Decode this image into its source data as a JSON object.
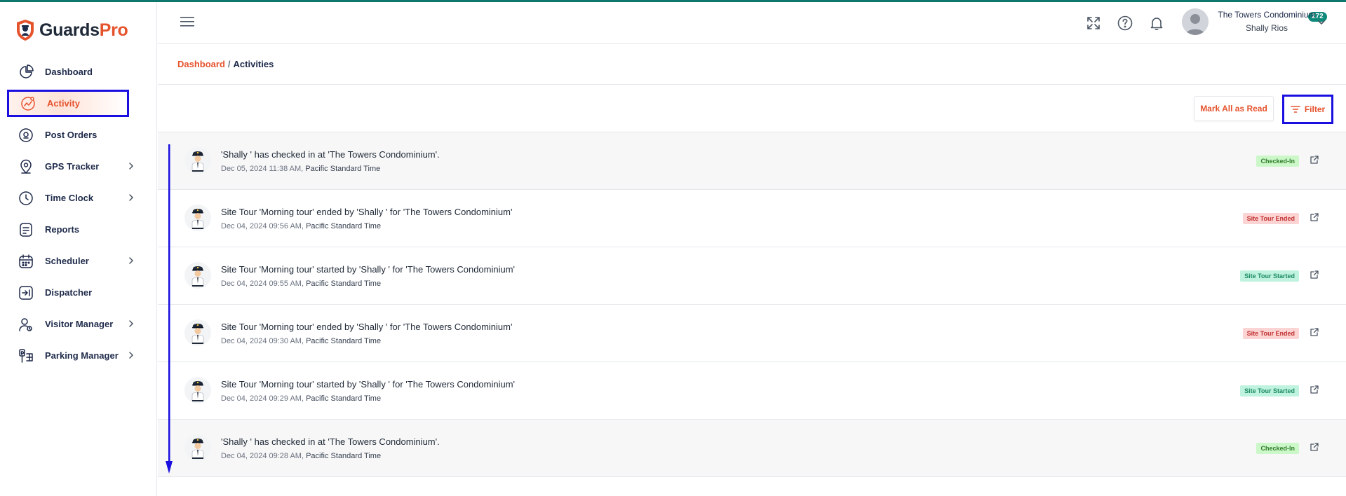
{
  "brand": {
    "name_part1": "Guards",
    "name_part2": "Pro"
  },
  "sidebar": {
    "items": [
      {
        "label": "Dashboard",
        "icon": "pie-chart-icon",
        "has_chevron": false
      },
      {
        "label": "Activity",
        "icon": "activity-icon",
        "has_chevron": false,
        "active": true
      },
      {
        "label": "Post Orders",
        "icon": "location-pin-icon",
        "has_chevron": false
      },
      {
        "label": "GPS Tracker",
        "icon": "map-pin-icon",
        "has_chevron": true
      },
      {
        "label": "Time Clock",
        "icon": "clock-icon",
        "has_chevron": true
      },
      {
        "label": "Reports",
        "icon": "report-icon",
        "has_chevron": false
      },
      {
        "label": "Scheduler",
        "icon": "calendar-icon",
        "has_chevron": true
      },
      {
        "label": "Dispatcher",
        "icon": "dispatch-icon",
        "has_chevron": false
      },
      {
        "label": "Visitor Manager",
        "icon": "visitor-icon",
        "has_chevron": true
      },
      {
        "label": "Parking Manager",
        "icon": "parking-icon",
        "has_chevron": true
      }
    ]
  },
  "topbar": {
    "notifications_count": "272",
    "org_name": "The Towers Condominium",
    "user_name": "Shally Rios"
  },
  "breadcrumb": {
    "root": "Dashboard",
    "separator": "/",
    "current": "Activities"
  },
  "actions": {
    "mark_all_label": "Mark All as Read",
    "filter_label": "Filter"
  },
  "activities": [
    {
      "message": "'Shally ' has checked in at 'The Towers Condominium'.",
      "date": "Dec 05, 2024 11:38 AM,",
      "timezone": "Pacific Standard Time",
      "status": "Checked-In",
      "status_type": "checked",
      "shaded": true
    },
    {
      "message": "Site Tour 'Morning tour' ended by 'Shally ' for 'The Towers Condominium'",
      "date": "Dec 04, 2024 09:56 AM,",
      "timezone": "Pacific Standard Time",
      "status": "Site Tour Ended",
      "status_type": "ended",
      "shaded": false
    },
    {
      "message": "Site Tour 'Morning tour' started by 'Shally ' for 'The Towers Condominium'",
      "date": "Dec 04, 2024 09:55 AM,",
      "timezone": "Pacific Standard Time",
      "status": "Site Tour Started",
      "status_type": "started",
      "shaded": false
    },
    {
      "message": "Site Tour 'Morning tour' ended by 'Shally ' for 'The Towers Condominium'",
      "date": "Dec 04, 2024 09:30 AM,",
      "timezone": "Pacific Standard Time",
      "status": "Site Tour Ended",
      "status_type": "ended",
      "shaded": false
    },
    {
      "message": "Site Tour 'Morning tour' started by 'Shally ' for 'The Towers Condominium'",
      "date": "Dec 04, 2024 09:29 AM,",
      "timezone": "Pacific Standard Time",
      "status": "Site Tour Started",
      "status_type": "started",
      "shaded": false
    },
    {
      "message": "'Shally ' has checked in at 'The Towers Condominium'.",
      "date": "Dec 04, 2024 09:28 AM,",
      "timezone": "Pacific Standard Time",
      "status": "Checked-In",
      "status_type": "checked",
      "shaded": true
    }
  ],
  "colors": {
    "accent": "#e5532d",
    "nav_text": "#1e2a4a",
    "annotation": "#1a0fe0",
    "badge": "#0f8a7a"
  }
}
